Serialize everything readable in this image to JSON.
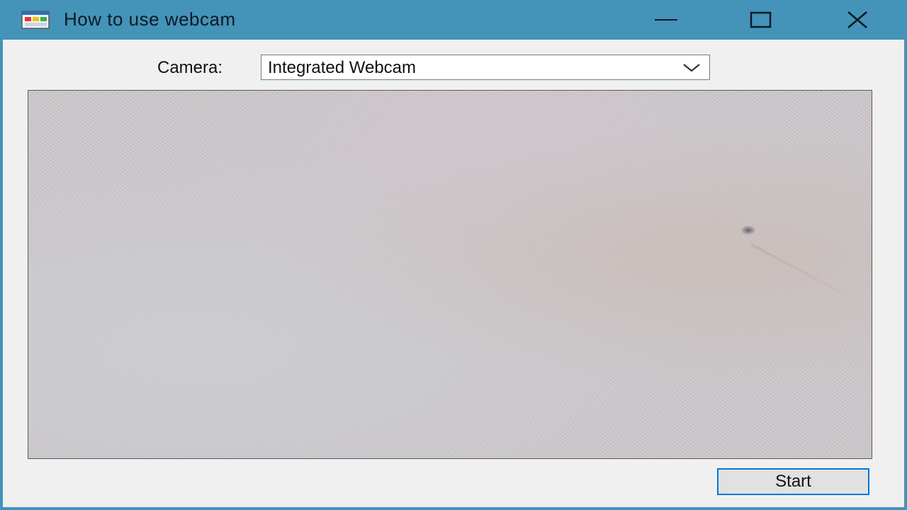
{
  "window": {
    "title": "How to use webcam",
    "title_bar_color": "#4493b8",
    "app_icon": "app-window-icon",
    "controls": {
      "minimize_icon": "minimize-icon",
      "maximize_icon": "maximize-icon",
      "close_icon": "close-icon"
    }
  },
  "form": {
    "camera_label": "Camera:",
    "camera_select": {
      "value": "Integrated Webcam",
      "arrow_icon": "chevron-down-icon"
    },
    "preview": {
      "icon": "webcam-preview"
    },
    "start_button": "Start",
    "accent_color": "#0078d7"
  }
}
